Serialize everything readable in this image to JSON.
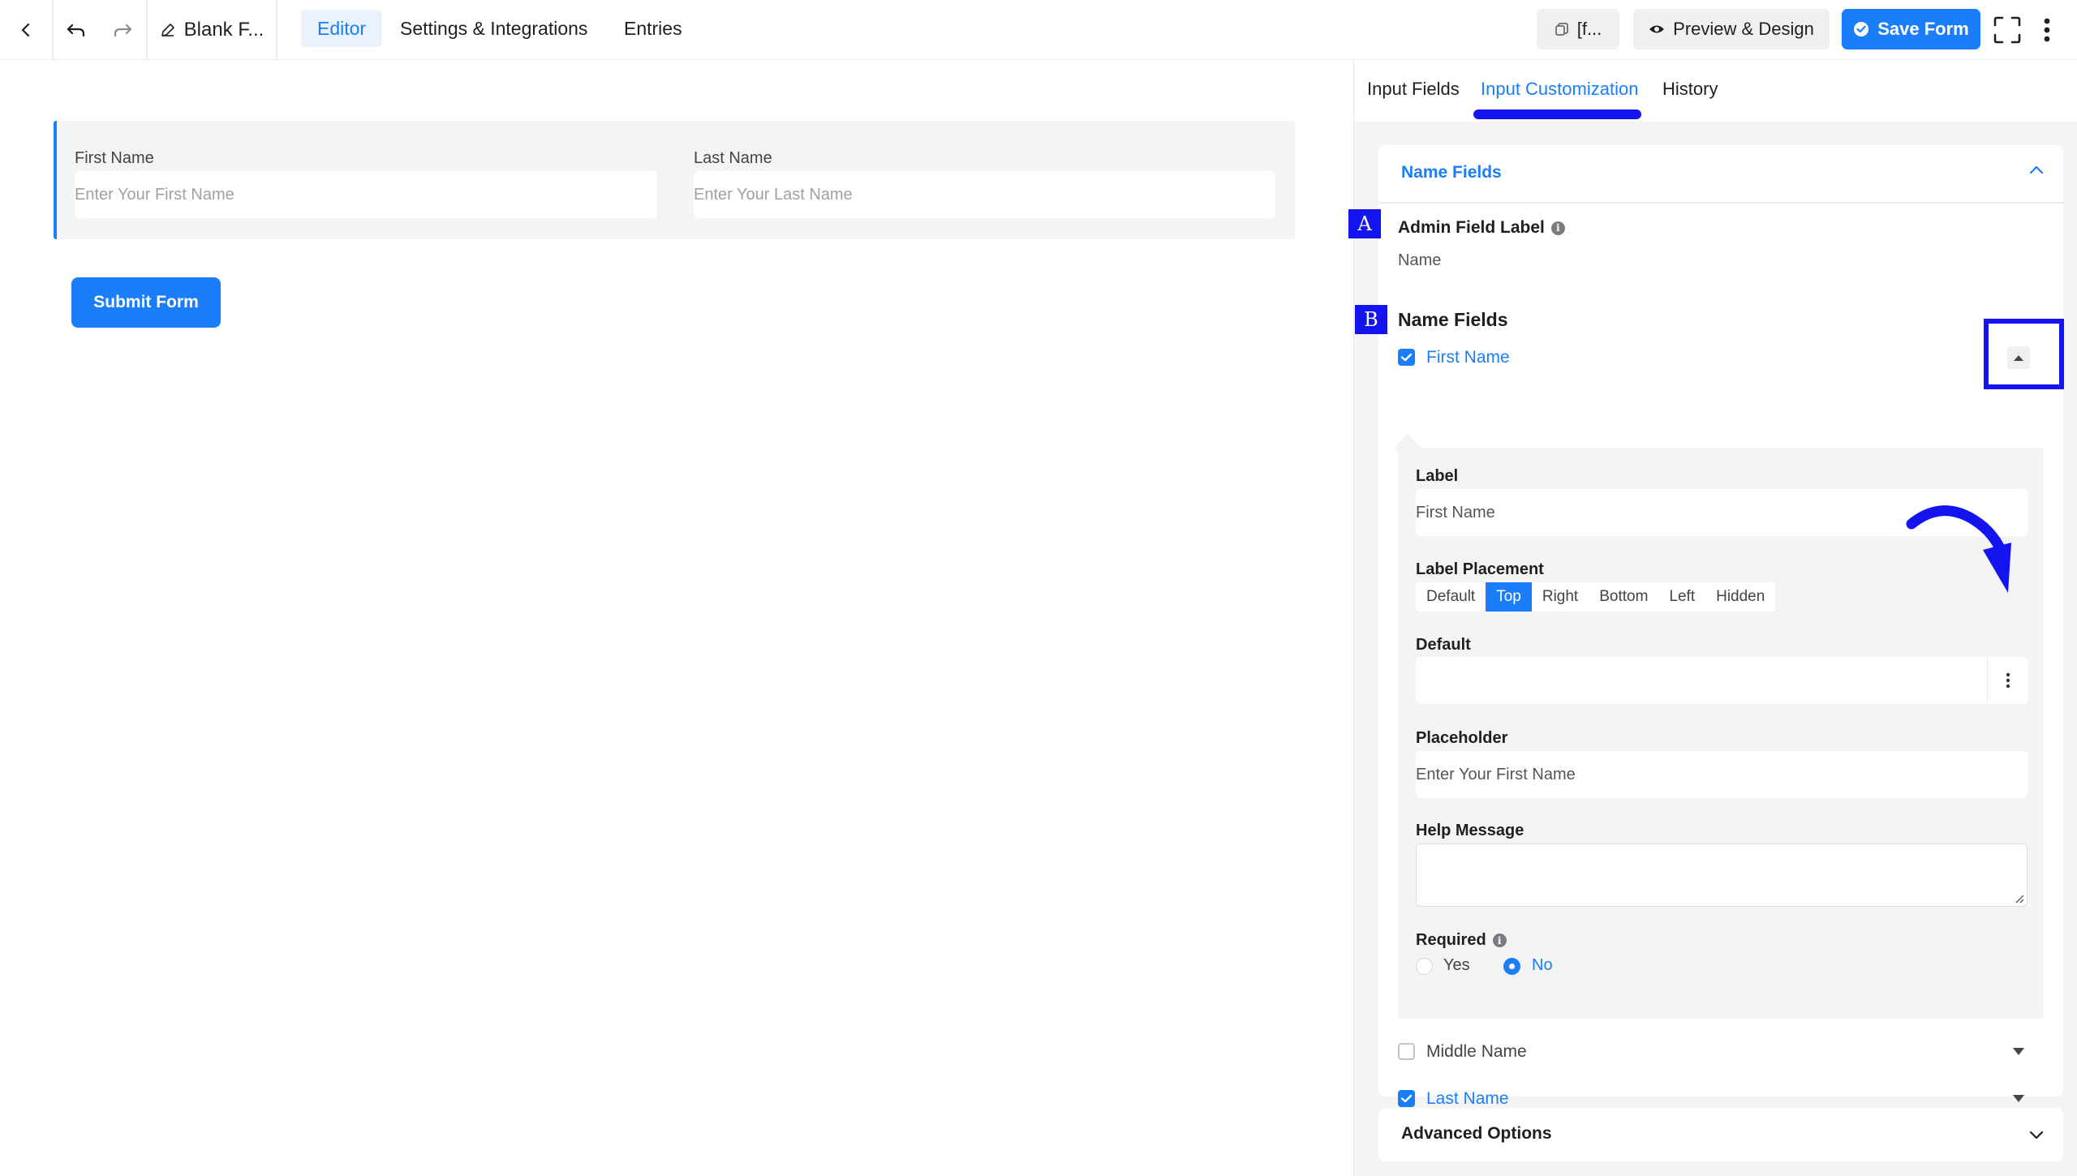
{
  "topbar": {
    "form_title": "Blank F...",
    "tabs": [
      "Editor",
      "Settings & Integrations",
      "Entries"
    ],
    "shortcode_label": "[f...",
    "preview_label": "Preview & Design",
    "save_label": "Save Form"
  },
  "canvas": {
    "first_name_label": "First Name",
    "first_name_placeholder": "Enter Your First Name",
    "last_name_label": "Last Name",
    "last_name_placeholder": "Enter Your Last Name",
    "submit_label": "Submit Form"
  },
  "sidebar": {
    "tabs": [
      "Input Fields",
      "Input Customization",
      "History"
    ],
    "panel_title": "Name Fields",
    "admin_field_label": "Admin Field Label",
    "admin_field_value": "Name",
    "name_fields_heading": "Name Fields",
    "markers": [
      "A",
      "B"
    ],
    "first_name_toggle": "First Name",
    "sub": {
      "label_title": "Label",
      "label_value": "First Name",
      "placement_title": "Label Placement",
      "placement_options": [
        "Default",
        "Top",
        "Right",
        "Bottom",
        "Left",
        "Hidden"
      ],
      "placement_selected": "Top",
      "default_title": "Default",
      "default_value": "",
      "placeholder_title": "Placeholder",
      "placeholder_value": "Enter Your First Name",
      "help_title": "Help Message",
      "help_value": "",
      "required_title": "Required",
      "required_yes": "Yes",
      "required_no": "No",
      "required_selected": "No"
    },
    "middle_name": "Middle Name",
    "last_name": "Last Name",
    "advanced_options": "Advanced Options"
  },
  "colors": {
    "accent": "#1a7efb",
    "annotation": "#1414f0",
    "panel_bg": "#f4f4f5"
  }
}
